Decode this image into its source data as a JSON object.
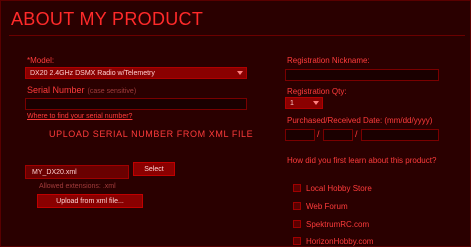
{
  "title": "ABOUT MY PRODUCT",
  "left": {
    "model_label": "*Model:",
    "model_value": "DX20 2.4GHz DSMX Radio w/Telemetry",
    "serial_label": "Serial Number",
    "serial_hint": "(case sensitive)",
    "serial_value": "",
    "find_serial_link": "Where to find your serial number?",
    "upload_heading": "UPLOAD SERIAL NUMBER FROM XML FILE",
    "file_name": "MY_DX20.xml",
    "select_button": "Select",
    "allowed_ext": "Allowed extensions: .xml",
    "upload_button": "Upload from xml file..."
  },
  "right": {
    "nickname_label": "Registration Nickname:",
    "nickname_value": "",
    "qty_label": "Registration Qty:",
    "qty_value": "1",
    "date_label": "Purchased/Received Date: (mm/dd/yyyy)",
    "date_mm": "",
    "date_dd": "",
    "date_yyyy": "",
    "date_separator": "/",
    "learn_label": "How did you first learn about this product?",
    "options": [
      {
        "label": "Local Hobby Store",
        "checked": false
      },
      {
        "label": "Web Forum",
        "checked": false
      },
      {
        "label": "SpektrumRC.com",
        "checked": false
      },
      {
        "label": "HorizonHobby.com",
        "checked": false
      }
    ]
  },
  "colors": {
    "accent": "#ff3b3b",
    "panel_bg": "#2a0000",
    "control_bg": "#8a0000"
  }
}
